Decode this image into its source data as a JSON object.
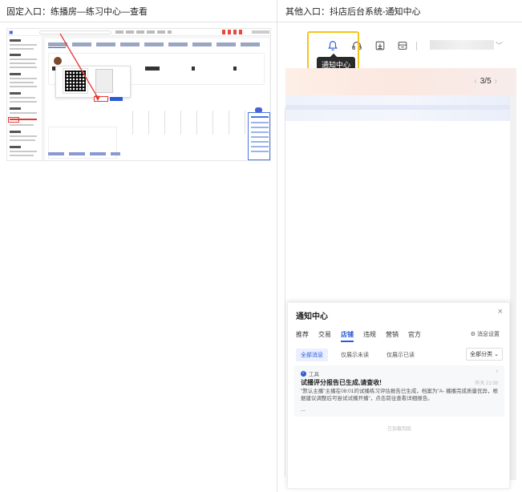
{
  "captions": {
    "left": "固定入口：练播房—练习中心—查看",
    "right": "其他入口：抖店后台系统-通知中心"
  },
  "toolbar": {
    "icons": [
      "bell-icon",
      "help-icon",
      "download-icon",
      "store-icon"
    ],
    "tooltip": "通知中心",
    "highlight_color": "#f5c518"
  },
  "banner": {
    "pager": "3/5",
    "prev": "‹",
    "next": "›"
  },
  "notification_center": {
    "title": "通知中心",
    "close": "×",
    "tabs": [
      "推荐",
      "交易",
      "店铺",
      "违规",
      "营销",
      "官方"
    ],
    "active_tab": "店铺",
    "settings_label": "消息设置",
    "filters": [
      "全部消息",
      "仅展示未读",
      "仅展示已读"
    ],
    "active_filter": "全部消息",
    "category_select": "全部分类",
    "message": {
      "source": "工具",
      "title": "试播评分报告已生成,请查收!",
      "time": "昨天 21:08",
      "body": "\"默认主播\"主播在08:01的试播练习评估报告已生成，档案为\"A- 播播完成质量优异，根据建议调整后可尝试试播开播\"，点击前往查看详细报告。",
      "more": "..."
    },
    "end_text": "已加载到底"
  },
  "colors": {
    "accent": "#2d5bd7",
    "annotation_red": "#e53935"
  }
}
